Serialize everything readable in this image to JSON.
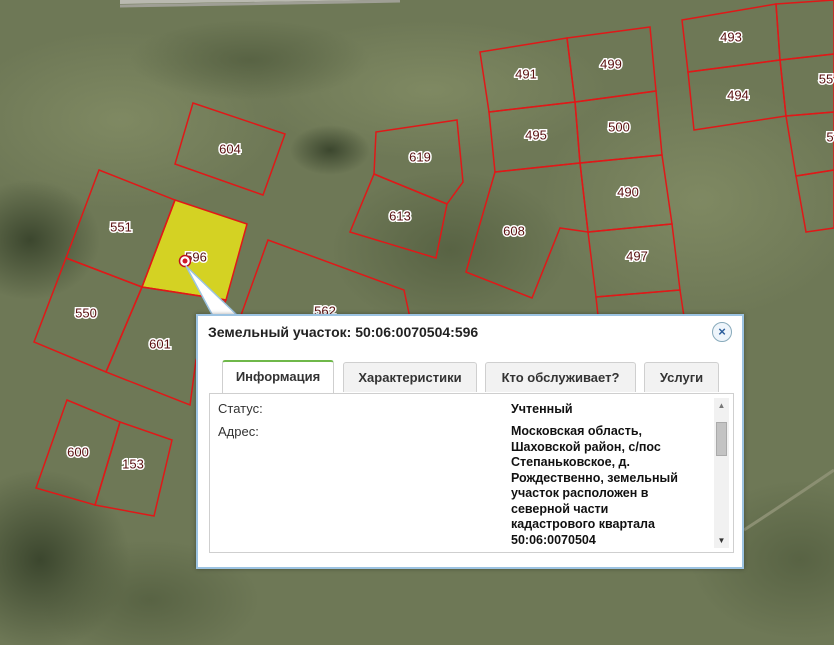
{
  "parcels": [
    {
      "id": "491",
      "label": "491"
    },
    {
      "id": "499",
      "label": "499"
    },
    {
      "id": "495",
      "label": "495"
    },
    {
      "id": "500",
      "label": "500"
    },
    {
      "id": "490",
      "label": "490"
    },
    {
      "id": "497",
      "label": "497"
    },
    {
      "id": "608",
      "label": "608"
    },
    {
      "id": "493",
      "label": "493"
    },
    {
      "id": "494",
      "label": "494"
    },
    {
      "id": "604",
      "label": "604"
    },
    {
      "id": "619",
      "label": "619"
    },
    {
      "id": "613",
      "label": "613"
    },
    {
      "id": "551",
      "label": "551"
    },
    {
      "id": "596",
      "label": "596"
    },
    {
      "id": "550",
      "label": "550"
    },
    {
      "id": "601",
      "label": "601"
    },
    {
      "id": "562",
      "label": "562"
    },
    {
      "id": "600",
      "label": "600"
    },
    {
      "id": "153",
      "label": "153"
    },
    {
      "id": "55x",
      "label": "55"
    },
    {
      "id": "5xx",
      "label": "5"
    }
  ],
  "colors": {
    "parcel_border": "#e01818",
    "selected_fill": "#e6e21a",
    "popup_border": "#9cc3e2",
    "tab_active_accent": "#6fb84a"
  },
  "popup": {
    "title": "Земельный участок: 50:06:0070504:596",
    "close_icon": "×",
    "tabs": [
      {
        "label": "Информация",
        "active": true
      },
      {
        "label": "Характеристики",
        "active": false
      },
      {
        "label": "Кто обслуживает?",
        "active": false
      },
      {
        "label": "Услуги",
        "active": false
      }
    ],
    "info": {
      "status_label": "Статус:",
      "status_value": "Учтенный",
      "address_label": "Адрес:",
      "address_lines": [
        "Московская область,",
        "Шаховской район, с/пос",
        "Степаньковское, д.",
        "Рождественно, земельный",
        "участок расположен в",
        "северной части",
        "кадастрового квартала",
        "50:06:0070504"
      ]
    },
    "scroll_up_icon": "▲",
    "scroll_down_icon": "▼"
  }
}
